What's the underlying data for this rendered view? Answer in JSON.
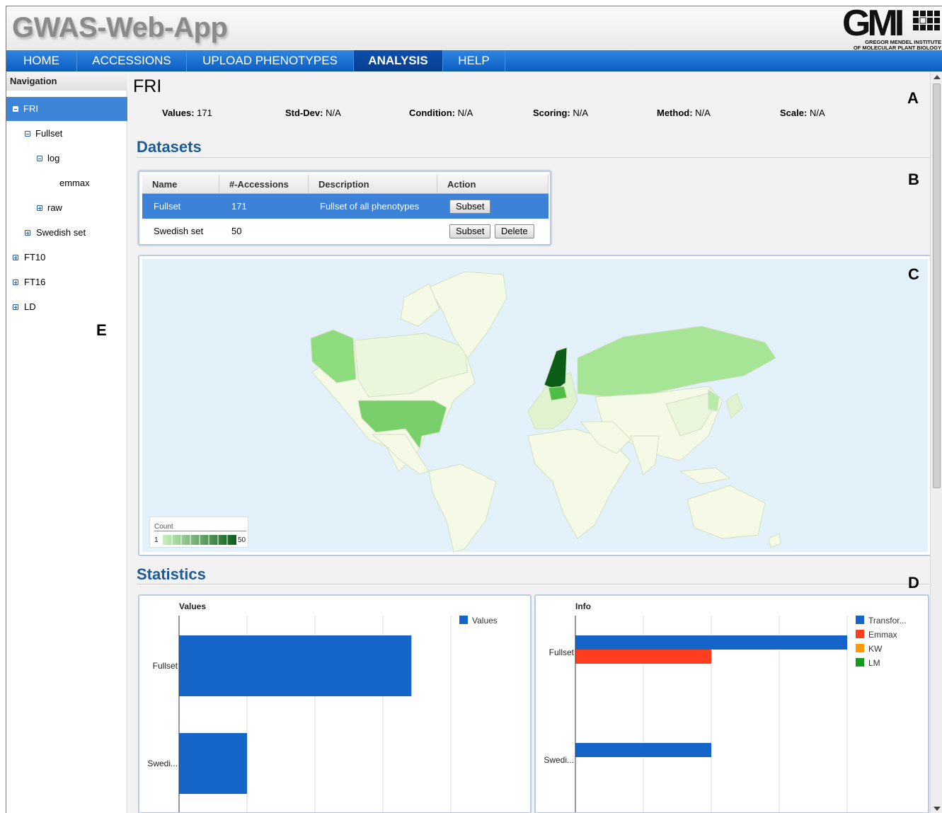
{
  "header": {
    "app_title": "GWAS-Web-App",
    "logo_text": "GMI",
    "logo_sub_1": "GREGOR MENDEL INSTITUTE",
    "logo_sub_2": "OF MOLECULAR PLANT BIOLOGY"
  },
  "nav": {
    "tabs": [
      {
        "label": "HOME"
      },
      {
        "label": "ACCESSIONS"
      },
      {
        "label": "UPLOAD PHENOTYPES"
      },
      {
        "label": "ANALYSIS",
        "active": true
      },
      {
        "label": "HELP"
      }
    ]
  },
  "sidebar": {
    "header": "Navigation",
    "items": [
      {
        "label": "FRI",
        "toggle": "minus",
        "selected": true
      },
      {
        "label": "Fullset",
        "toggle": "minus"
      },
      {
        "label": "log",
        "toggle": "minus"
      },
      {
        "label": "emmax"
      },
      {
        "label": "raw",
        "toggle": "plus"
      },
      {
        "label": "Swedish set",
        "toggle": "plus"
      },
      {
        "label": "FT10",
        "toggle": "plus"
      },
      {
        "label": "FT16",
        "toggle": "plus"
      },
      {
        "label": "LD",
        "toggle": "plus"
      }
    ]
  },
  "panel_letters": {
    "a": "A",
    "b": "B",
    "c": "C",
    "d": "D",
    "e": "E"
  },
  "phenotype": {
    "title": "FRI",
    "props": [
      {
        "label": "Values:",
        "value": "171"
      },
      {
        "label": "Std-Dev:",
        "value": "N/A"
      },
      {
        "label": "Condition:",
        "value": "N/A"
      },
      {
        "label": "Scoring:",
        "value": "N/A"
      },
      {
        "label": "Method:",
        "value": "N/A"
      },
      {
        "label": "Scale:",
        "value": "N/A"
      }
    ]
  },
  "datasets": {
    "title": "Datasets",
    "columns": [
      "Name",
      "#-Accessions",
      "Description",
      "Action"
    ],
    "rows": [
      {
        "name": "Fullset",
        "accessions": "171",
        "description": "Fullset of all phenotypes",
        "actions": [
          "Subset"
        ],
        "selected": true
      },
      {
        "name": "Swedish set",
        "accessions": "50",
        "description": "",
        "actions": [
          "Subset",
          "Delete"
        ],
        "selected": false
      }
    ]
  },
  "map": {
    "legend_title": "Count",
    "legend_min": "1",
    "legend_max": "50",
    "colors": {
      "ocean": "#e3f1fb",
      "land": "#f4fae6",
      "border": "#d5e2c8",
      "max": "#0b5d18",
      "min": "#c8f2bd"
    }
  },
  "statistics": {
    "title": "Statistics"
  },
  "chart_data": [
    {
      "type": "bar",
      "orientation": "horizontal",
      "title": "Values",
      "categories": [
        "Fullset",
        "Swedi..."
      ],
      "series": [
        {
          "name": "Values",
          "values": [
            171,
            50
          ],
          "color": "#1565c8"
        }
      ],
      "xlim": [
        0,
        200
      ],
      "grid": true,
      "legend": "top-right"
    },
    {
      "type": "bar",
      "orientation": "horizontal",
      "title": "Info",
      "categories": [
        "Fullset",
        "Swedi..."
      ],
      "series": [
        {
          "name": "Transfor...",
          "values": [
            2,
            1
          ],
          "color": "#1565c8"
        },
        {
          "name": "Emmax",
          "values": [
            1,
            0
          ],
          "color": "#ff3d1f"
        },
        {
          "name": "KW",
          "values": [
            0,
            0
          ],
          "color": "#ff9900"
        },
        {
          "name": "LM",
          "values": [
            0,
            0
          ],
          "color": "#16991f"
        }
      ],
      "xlim": [
        0,
        2
      ],
      "grid": true,
      "legend": "top-right"
    }
  ]
}
